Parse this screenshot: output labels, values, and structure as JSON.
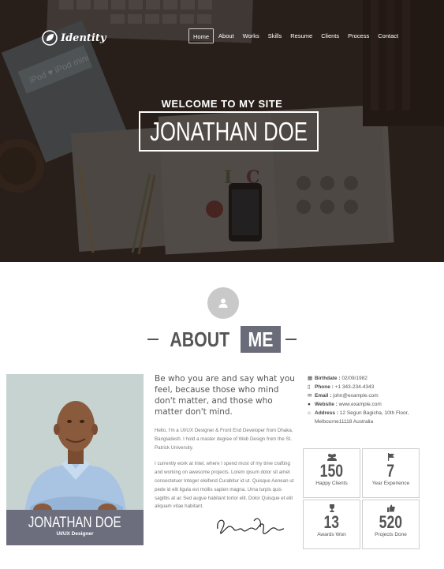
{
  "brand": {
    "name": "Identity"
  },
  "nav": {
    "items": [
      "Home",
      "About",
      "Works",
      "Skills",
      "Resume",
      "Clients",
      "Process",
      "Contact"
    ],
    "active": "Home"
  },
  "hero": {
    "welcome": "WELCOME TO MY SITE",
    "name": "JONATHAN DOE",
    "desk_labels": {
      "ipod_box": "iPod ♥ iPod mini"
    }
  },
  "about": {
    "title_left": "ABOUT",
    "title_right": "ME",
    "profile": {
      "name": "JONATHAN DOE",
      "role": "UI/UX Designer"
    },
    "quote": "Be who you are and say what you feel, because those who mind don't matter, and those who matter don't mind.",
    "paragraphs": [
      "Hello, I'm a UI/UX Designer & Front End Developer from Dhaka, Bangladesh. I hold a master degree of Web Design from the St. Patrick University.",
      "I currently work at Intel, where I spend most of my time crafting and working on awesome projects. Lorem ipsum dolor sit amet consectetuer Integer eleifend Curabitur id ut. Quisque Aenean ut pede id elit ligula est mollis sapien magna. Urna turpis quis sagittis at ac Sed augue habitant tortor elit. Dolor Quisque et elit aliquam vitae habitant."
    ],
    "info": {
      "birthdate": {
        "label": "Birthdate :",
        "value": "02/09/1982"
      },
      "phone": {
        "label": "Phone :",
        "value": "+1 343-234-4343"
      },
      "email": {
        "label": "Email :",
        "value": "john@example.com"
      },
      "website": {
        "label": "Website :",
        "value": "www.example.com"
      },
      "address": {
        "label": "Address :",
        "value": "12 Segun Bagicha, 10th Floor,",
        "value2": "Melbourne11118 Australia"
      }
    },
    "stats": [
      {
        "icon": "users-icon",
        "value": "150",
        "label": "Happy Clients"
      },
      {
        "icon": "flag-icon",
        "value": "7",
        "label": "Year Experience"
      },
      {
        "icon": "trophy-icon",
        "value": "13",
        "label": "Awards Won"
      },
      {
        "icon": "thumbs-up-icon",
        "value": "520",
        "label": "Projects Done"
      }
    ]
  },
  "colors": {
    "hero_overlay": "#2a211c",
    "accent": "#6a6c7a",
    "text": "#555555",
    "icon_circle": "#c9c9c9"
  }
}
